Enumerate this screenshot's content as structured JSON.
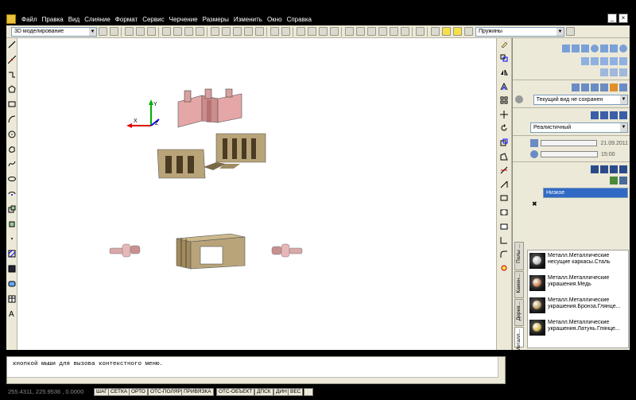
{
  "menu": {
    "items": [
      "Файл",
      "Правка",
      "Вид",
      "Слияние",
      "Формат",
      "Сервис",
      "Черчение",
      "Размеры",
      "Изменить",
      "Окно",
      "Справка"
    ]
  },
  "toolbar": {
    "workspace_combo": "3D моделирование",
    "layer_combo": "Пружины"
  },
  "right_panel": {
    "view_combo": "Текущий вид не сохранен",
    "visual_style_combo": "Реалистичный",
    "date_value": "21.09.2011",
    "time_value": "15:00",
    "quality_combo": "Низкое"
  },
  "palette": {
    "tabs": [
      "Полы ...",
      "Камен...",
      "Дерев...",
      "Металл..."
    ],
    "materials": [
      {
        "label_line1": "Металл.Металлические",
        "label_line2": "несущие каркасы.Сталь",
        "color": "#c0c0c0"
      },
      {
        "label_line1": "Металл.Металлические",
        "label_line2": "украшения.Медь",
        "color": "#c47a4a"
      },
      {
        "label_line1": "Металл.Металлические",
        "label_line2": "украшения.Бронза.Глянце...",
        "color": "#b89a5a"
      },
      {
        "label_line1": "Металл.Металлические",
        "label_line2": "украшения.Латунь.Глянце...",
        "color": "#d4b44a"
      }
    ]
  },
  "command_line": {
    "text": "кнопкой мыши для вызова контекстного меню."
  },
  "status_bar": {
    "coords": "255.4311, 225.9536 , 0.0000",
    "buttons": [
      "ШАГ",
      "СЕТКА",
      "ОРТО",
      "ОТС-ПОЛЯР",
      "ПРИВЯЗКА",
      "ОТС-ОБЪЕКТ",
      "ДПСК",
      "ДИН",
      "ВЕС"
    ]
  },
  "colors": {
    "pink_part": "#e4a6a6",
    "tan_part": "#b9a47a",
    "axis_y": "#00b000",
    "axis_x": "#e00000",
    "axis_z": "#0000ff"
  }
}
